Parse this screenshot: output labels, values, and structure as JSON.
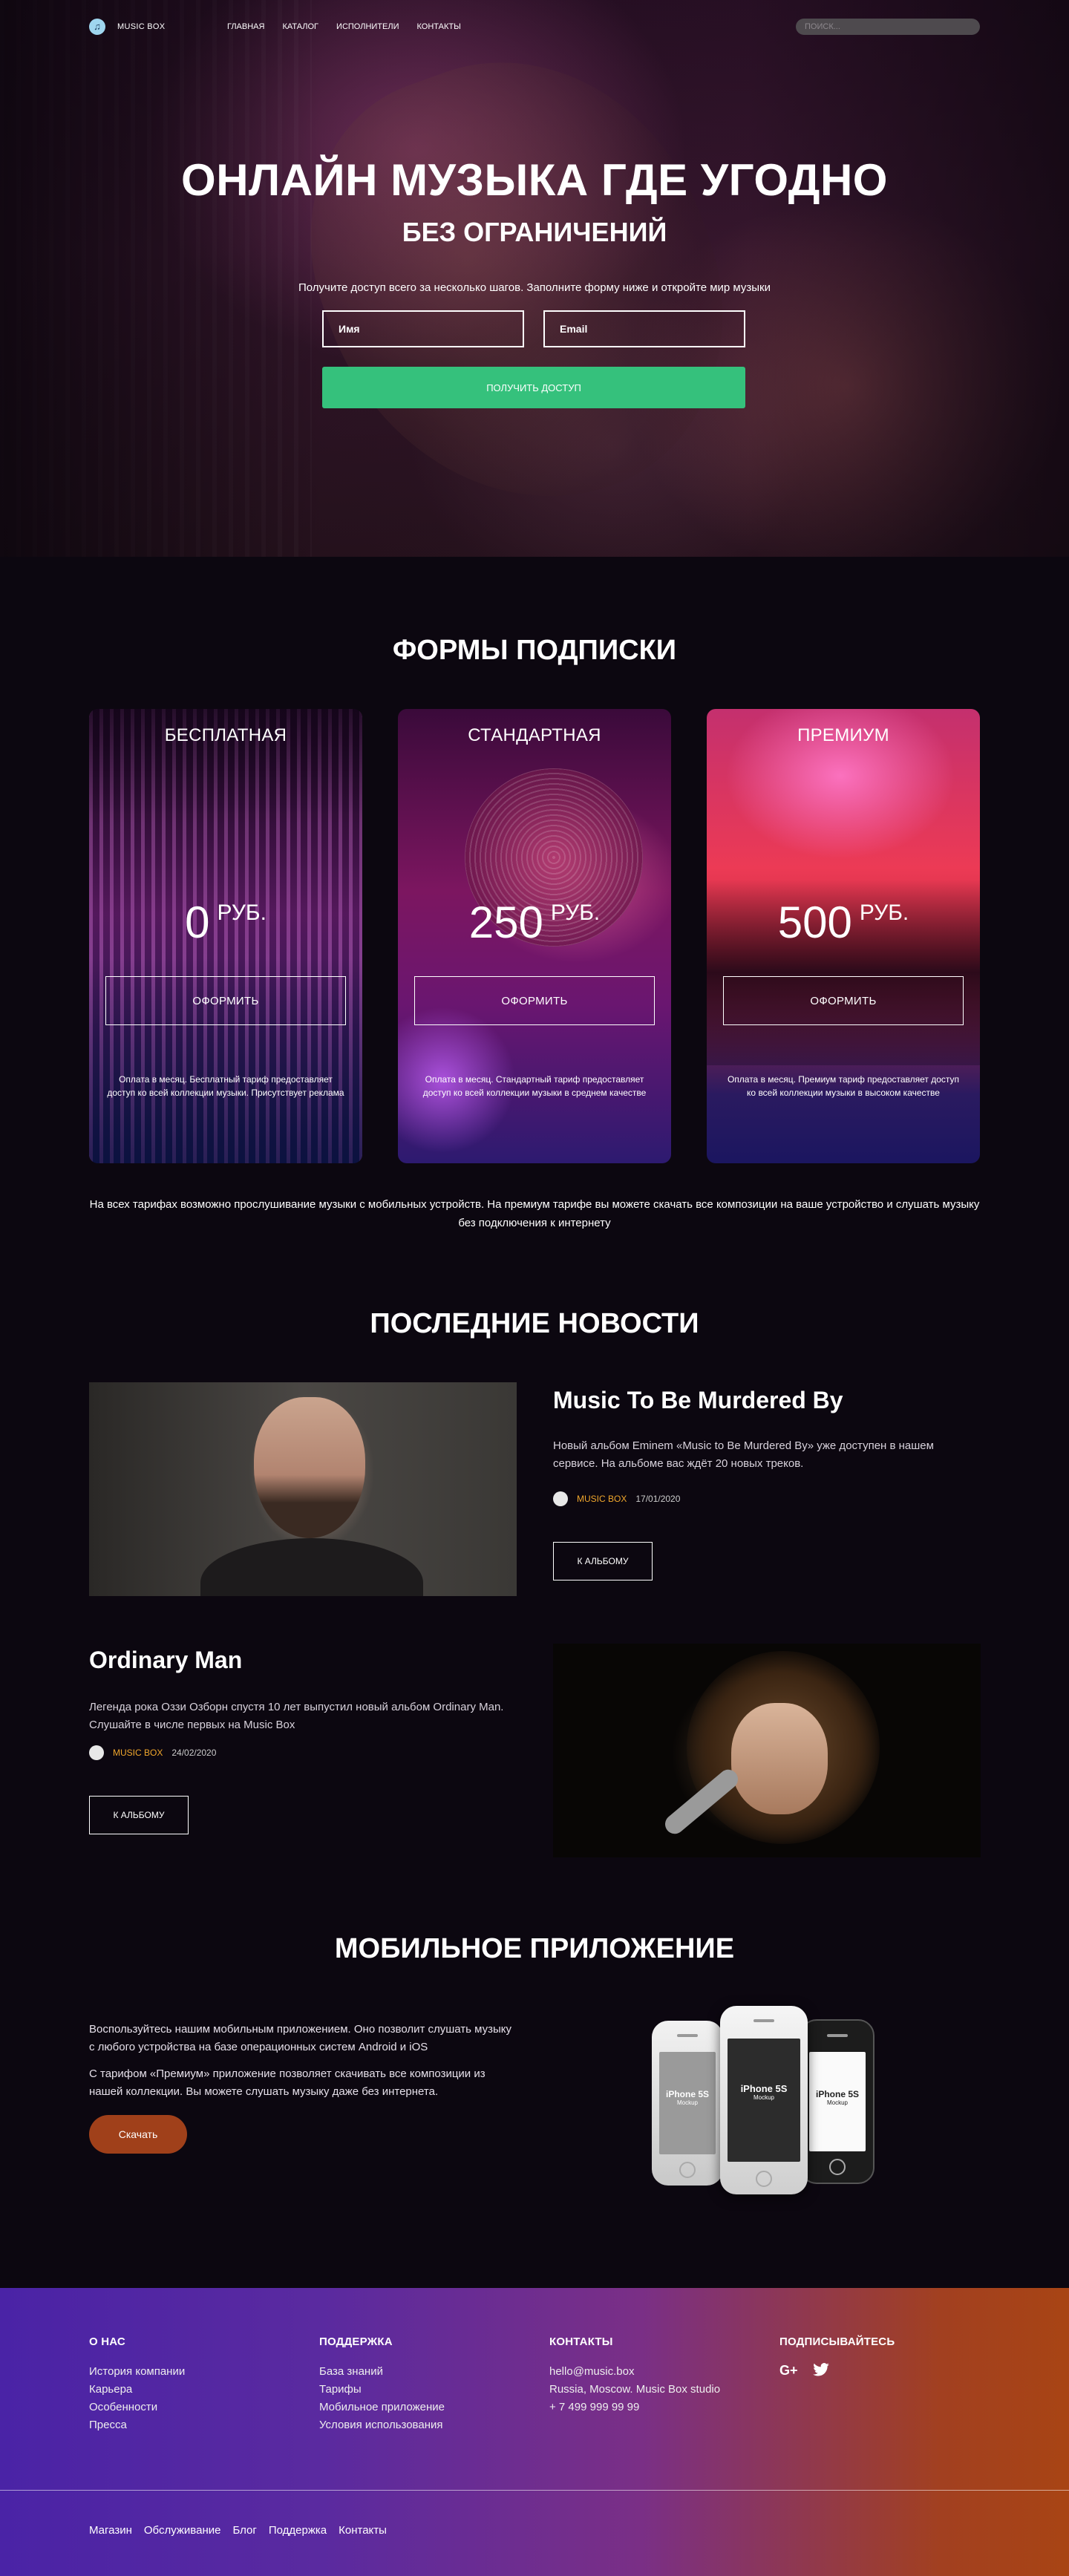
{
  "nav": {
    "logo": "MUSIC BOX",
    "items": [
      "ГЛАВНАЯ",
      "КАТАЛОГ",
      "ИСПОЛНИТЕЛИ",
      "КОНТАКТЫ"
    ],
    "search_placeholder": "ПОИСК..."
  },
  "hero": {
    "title": "ОНЛАЙН МУЗЫКА ГДЕ УГОДНО",
    "subtitle": "БЕЗ ОГРАНИЧЕНИЙ",
    "text": "Получите доступ всего за несколько шагов. Заполните форму ниже и откройте мир музыки",
    "name_placeholder": "Имя",
    "email_placeholder": "Email",
    "button": "ПОЛУЧИТЬ ДОСТУП"
  },
  "plans": {
    "title": "ФОРМЫ ПОДПИСКИ",
    "items": [
      {
        "name": "БЕСПЛАТНАЯ",
        "price": "0",
        "currency": "РУБ.",
        "button": "ОФОРМИТЬ",
        "description": "Оплата в месяц. Бесплатный тариф предоставляет доступ ко всей коллекции музыки. Присутствует реклама"
      },
      {
        "name": "СТАНДАРТНАЯ",
        "price": "250",
        "currency": "РУБ.",
        "button": "ОФОРМИТЬ",
        "description": "Оплата в месяц. Стандартный тариф предоставляет доступ ко всей коллекции музыки в среднем качестве"
      },
      {
        "name": "ПРЕМИУМ",
        "price": "500",
        "currency": "РУБ.",
        "button": "ОФОРМИТЬ",
        "description": "Оплата в месяц. Премиум тариф предоставляет доступ ко всей коллекции музыки в высоком качестве"
      }
    ],
    "note": "На всех тарифах возможно прослушивание музыки с мобильных устройств. На премиум тарифе вы можете скачать все композиции на ваше устройство и слушать музыку без подключения к интернету"
  },
  "news": {
    "title": "ПОСЛЕДНИЕ НОВОСТИ",
    "items": [
      {
        "title": "Music To Be Murdered By",
        "text": "Новый альбом Eminem «Music to Be Murdered By» уже доступен в нашем сервисе. На альбоме вас ждёт 20 новых треков.",
        "author": "MUSIC BOX",
        "date": "17/01/2020",
        "button": "К АЛЬБОМУ"
      },
      {
        "title": "Ordinary Man",
        "text": "Легенда рока Оззи Озборн спустя 10 лет выпустил новый альбом Ordinary Man. Слушайте в числе первых на Music Box",
        "author": "MUSIC BOX",
        "date": "24/02/2020",
        "button": "К АЛЬБОМУ"
      }
    ]
  },
  "app": {
    "title": "МОБИЛЬНОЕ ПРИЛОЖЕНИЕ",
    "text1": "Воспользуйтесь нашим мобильным приложением. Оно позволит слушать музыку с любого устройства на базе операционных систем Android и iOS",
    "text2": "С тарифом «Премиум» приложение позволяет скачивать все композиции из нашей коллекции. Вы можете слушать музыку даже без интернета.",
    "button": "Скачать",
    "phone_label": "iPhone 5S",
    "phone_sub": "Mockup"
  },
  "footer": {
    "about": {
      "title": "О НАС",
      "items": [
        "История компании",
        "Карьера",
        "Особенности",
        "Пресса"
      ]
    },
    "support": {
      "title": "ПОДДЕРЖКА",
      "items": [
        "База знаний",
        "Тарифы",
        "Мобильное приложение",
        "Условия использования"
      ]
    },
    "contacts": {
      "title": "КОНТАКТЫ",
      "items": [
        "hello@music.box",
        "Russia, Moscow. Music Box studio",
        "+ 7 499 999 99 99"
      ]
    },
    "subscribe": {
      "title": "ПОДПИСЫВАЙТЕСЬ",
      "google": "G+"
    },
    "bottom": [
      "Магазин",
      "Обслуживание",
      "Блог",
      "Поддержка",
      "Контакты"
    ]
  }
}
